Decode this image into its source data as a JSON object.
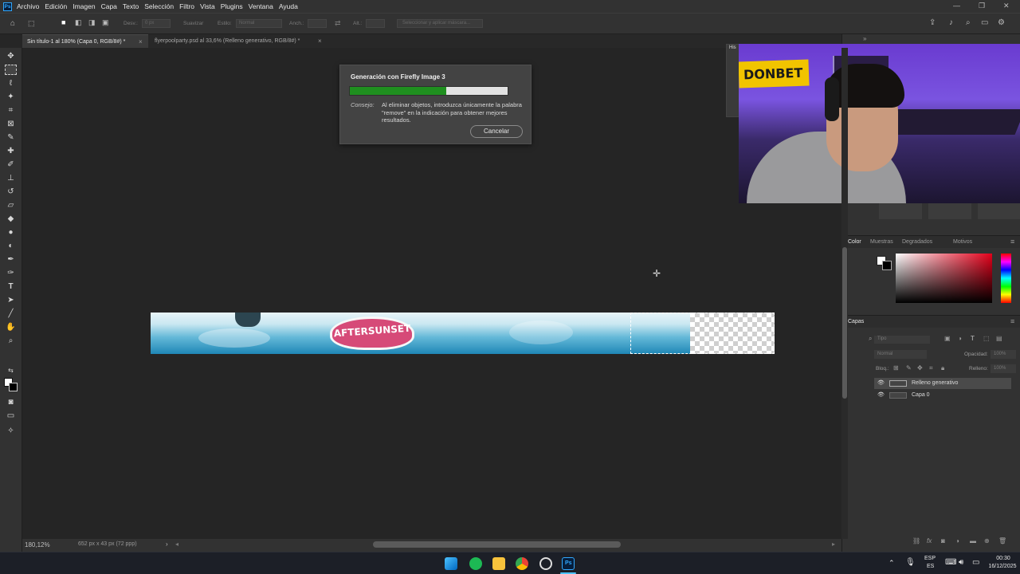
{
  "app": {
    "logo_text": "Ps",
    "menu": [
      "Archivo",
      "Edición",
      "Imagen",
      "Capa",
      "Texto",
      "Selección",
      "Filtro",
      "Vista",
      "Plugins",
      "Ventana",
      "Ayuda"
    ]
  },
  "options_bar": {
    "feather_label": "Desv.:",
    "feather_value": "0 px",
    "smooth_label": "Suavizar",
    "style_label": "Estilo:",
    "style_value": "Normal",
    "width_label": "Anch.:",
    "height_label": "Alt.:",
    "mask_button": "Seleccionar y aplicar máscara..."
  },
  "tabs": [
    {
      "label": "Sin título-1 al 180% (Capa 0, RGB/8#) *",
      "active": true
    },
    {
      "label": "flyerpoolparty.psd al 33,6% (Relleno generativo, RGB/8#) *",
      "active": false
    }
  ],
  "canvas": {
    "banner_text": "AFTERSUNSET"
  },
  "dialog": {
    "title": "Generación con Firefly Image 3",
    "progress": 0.61,
    "tip_label": "Consejo:",
    "tip_text": "Al eliminar objetos, introduzca únicamente la palabra \"remove\" en la indicación para obtener mejores resultados.",
    "cancel_label": "Cancelar"
  },
  "webcam": {
    "sign_text": "DONBET"
  },
  "panels": {
    "history_tab": "His",
    "color_tabs": [
      "Color",
      "Muestras",
      "Degradados",
      "Motivos"
    ],
    "layers_title": "Capas",
    "search_placeholder": "Tipo",
    "blend_mode": "Normal",
    "opacity_label": "Opacidad:",
    "opacity_value": "100%",
    "lock_label": "Bloq.:",
    "fill_label": "Relleno:",
    "fill_value": "100%",
    "layers": [
      {
        "name": "Relleno generativo",
        "selected": true
      },
      {
        "name": "Capa 0",
        "selected": false
      }
    ]
  },
  "status_bar": {
    "zoom": "180,12%",
    "doc_info": "652 px x 43 px (72 ppp)"
  },
  "taskbar": {
    "lang_top": "ESP",
    "lang_bottom": "ES",
    "time": "00:30",
    "date": "16/12/2025"
  }
}
